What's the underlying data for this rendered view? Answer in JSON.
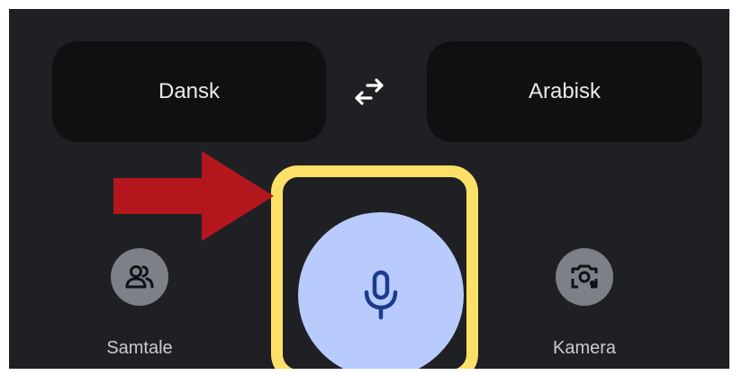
{
  "languages": {
    "source": "Dansk",
    "target": "Arabisk",
    "swap_icon": "swap-arrows-icon"
  },
  "actions": {
    "conversation": {
      "label": "Samtale",
      "icon": "people-icon"
    },
    "voice_input": {
      "icon": "microphone-icon"
    },
    "camera": {
      "label": "Kamera",
      "icon": "camera-lens-icon"
    }
  },
  "annotation": {
    "arrow_color": "#b3171d",
    "highlight_color": "#fde068"
  },
  "colors": {
    "background": "#1f2023",
    "language_button": "#0f1012",
    "mic_button": "#b9cafd",
    "mic_icon": "#1c3b8f",
    "round_button": "#7d8088"
  }
}
